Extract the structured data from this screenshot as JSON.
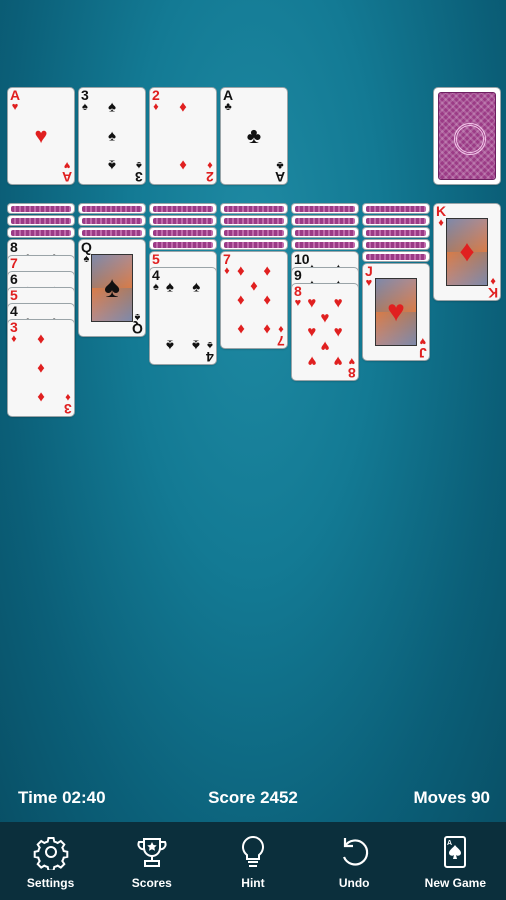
{
  "foundations": [
    {
      "rank": "A",
      "suit": "♥",
      "color": "red"
    },
    {
      "rank": "3",
      "suit": "♠",
      "color": "black"
    },
    {
      "rank": "2",
      "suit": "♦",
      "color": "red"
    },
    {
      "rank": "A",
      "suit": "♣",
      "color": "black"
    }
  ],
  "tableau": [
    {
      "hidden": 3,
      "cards": [
        {
          "rank": "8",
          "suit": "♣",
          "color": "black"
        },
        {
          "rank": "7",
          "suit": "♥",
          "color": "red"
        },
        {
          "rank": "6",
          "suit": "♠",
          "color": "black"
        },
        {
          "rank": "5",
          "suit": "♥",
          "color": "red"
        },
        {
          "rank": "4",
          "suit": "♣",
          "color": "black"
        },
        {
          "rank": "3",
          "suit": "♦",
          "color": "red"
        }
      ]
    },
    {
      "hidden": 3,
      "cards": [
        {
          "rank": "Q",
          "suit": "♠",
          "color": "black"
        }
      ]
    },
    {
      "hidden": 4,
      "cards": [
        {
          "rank": "5",
          "suit": "♥",
          "color": "red"
        },
        {
          "rank": "4",
          "suit": "♠",
          "color": "black"
        }
      ]
    },
    {
      "hidden": 4,
      "cards": [
        {
          "rank": "7",
          "suit": "♦",
          "color": "red"
        }
      ]
    },
    {
      "hidden": 4,
      "cards": [
        {
          "rank": "10",
          "suit": "♠",
          "color": "black"
        },
        {
          "rank": "9",
          "suit": "♠",
          "color": "black"
        },
        {
          "rank": "8",
          "suit": "♥",
          "color": "red"
        }
      ]
    },
    {
      "hidden": 5,
      "cards": [
        {
          "rank": "J",
          "suit": "♥",
          "color": "red"
        }
      ]
    },
    {
      "hidden": 0,
      "cards": [
        {
          "rank": "K",
          "suit": "♦",
          "color": "red"
        }
      ]
    }
  ],
  "status": {
    "time": "Time 02:40",
    "score": "Score 2452",
    "moves": "Moves 90"
  },
  "toolbar": {
    "settings": "Settings",
    "scores": "Scores",
    "hint": "Hint",
    "undo": "Undo",
    "new_game": "New Game"
  },
  "colors": {
    "red": "#e02020",
    "black": "#111111",
    "toolbar_bg": "#0b2f3c",
    "felt": "#137a94",
    "card_back": "#9b3b86"
  },
  "icons": {
    "settings": "gear-icon",
    "scores": "trophy-icon",
    "hint": "lightbulb-icon",
    "undo": "undo-icon",
    "new_game": "new-game-card-icon"
  }
}
